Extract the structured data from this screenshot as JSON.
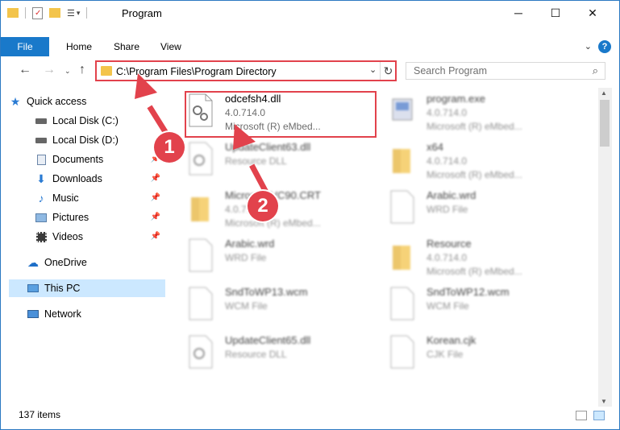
{
  "window": {
    "title": "Program",
    "minimize": "─",
    "maximize": "☐",
    "close": "✕"
  },
  "ribbon": {
    "tabs": [
      "File",
      "Home",
      "Share",
      "View"
    ],
    "help": "?"
  },
  "address": {
    "path": "C:\\Program Files\\Program Directory"
  },
  "search": {
    "placeholder": "Search Program"
  },
  "nav": {
    "quick_access": "Quick access",
    "items": [
      {
        "label": "Local Disk (C:)",
        "icon": "drive-icon",
        "pinned": false
      },
      {
        "label": "Local Disk (D:)",
        "icon": "drive-icon",
        "pinned": false
      },
      {
        "label": "Documents",
        "icon": "documents-icon",
        "pinned": true
      },
      {
        "label": "Downloads",
        "icon": "downloads-icon",
        "pinned": true
      },
      {
        "label": "Music",
        "icon": "music-icon",
        "pinned": true
      },
      {
        "label": "Pictures",
        "icon": "pictures-icon",
        "pinned": true
      },
      {
        "label": "Videos",
        "icon": "videos-icon",
        "pinned": true
      }
    ],
    "onedrive": "OneDrive",
    "this_pc": "This PC",
    "network": "Network"
  },
  "files": [
    {
      "name": "odcefsh4.dll",
      "line2": "4.0.714.0",
      "line3": "Microsoft (R) eMbed...",
      "icon": "dll-icon"
    },
    {
      "name": "program.exe",
      "line2": "4.0.714.0",
      "line3": "Microsoft (R) eMbed...",
      "icon": "exe-icon"
    },
    {
      "name": "UpdateClient63.dll",
      "line2": "Resource DLL",
      "line3": "",
      "icon": "dll-icon"
    },
    {
      "name": "x64",
      "line2": "4.0.714.0",
      "line3": "Microsoft (R) eMbed...",
      "icon": "folder-icon"
    },
    {
      "name": "Microsoft.VC90.CRT",
      "line2": "4.0.714.0",
      "line3": "Microsoft (R) eMbed...",
      "icon": "folder-icon"
    },
    {
      "name": "Arabic.wrd",
      "line2": "WRD File",
      "line3": "",
      "icon": "file-icon"
    },
    {
      "name": "Arabic.wrd",
      "line2": "WRD File",
      "line3": "",
      "icon": "file-icon"
    },
    {
      "name": "Resource",
      "line2": "4.0.714.0",
      "line3": "Microsoft (R) eMbed...",
      "icon": "folder-icon"
    },
    {
      "name": "SndToWP13.wcm",
      "line2": "WCM File",
      "line3": "",
      "icon": "file-icon"
    },
    {
      "name": "SndToWP12.wcm",
      "line2": "WCM File",
      "line3": "",
      "icon": "file-icon"
    },
    {
      "name": "UpdateClient65.dll",
      "line2": "Resource DLL",
      "line3": "",
      "icon": "dll-icon"
    },
    {
      "name": "Korean.cjk",
      "line2": "CJK File",
      "line3": "",
      "icon": "file-icon"
    }
  ],
  "status": {
    "count": "137 items"
  },
  "annotations": {
    "badge1": "1",
    "badge2": "2",
    "color": "#e2424c"
  }
}
